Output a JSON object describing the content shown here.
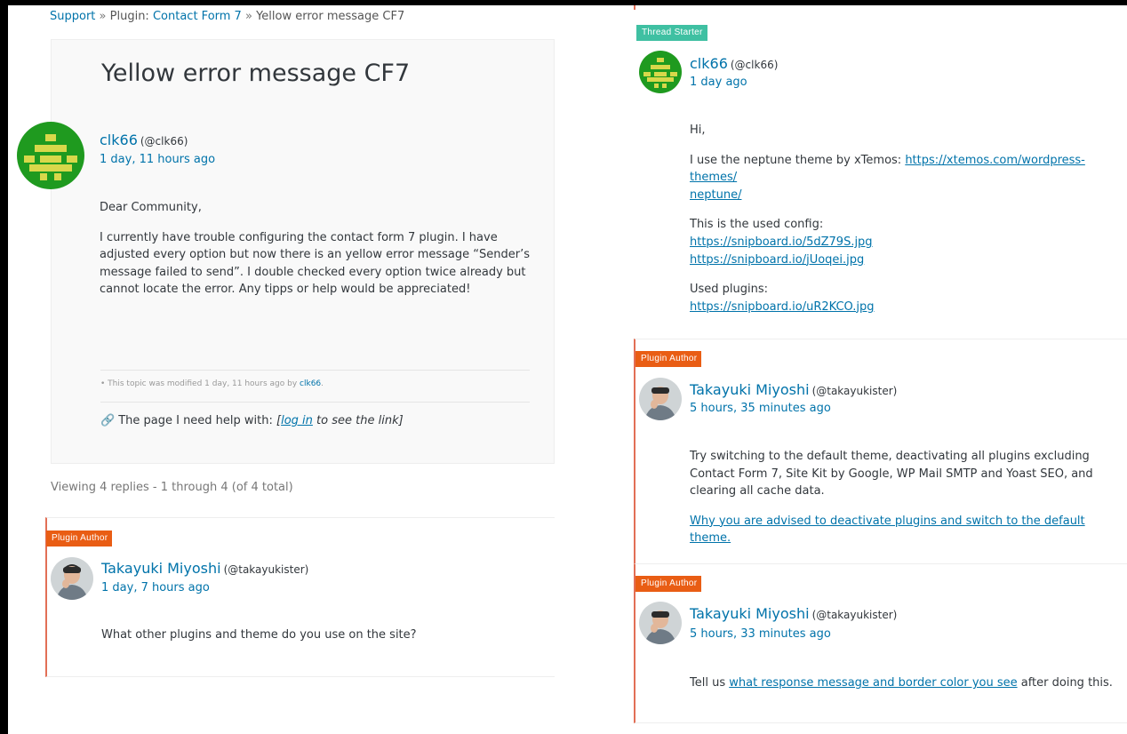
{
  "breadcrumb": {
    "support": "Support",
    "sep1": "»",
    "plugin_prefix": "Plugin:",
    "plugin_name": "Contact Form 7",
    "sep2": "»",
    "current": "Yellow error message CF7"
  },
  "topic": {
    "title": "Yellow error message CF7",
    "author_name": "clk66",
    "author_handle": "(@clk66)",
    "time": "1 day, 11 hours ago",
    "paragraphs": [
      "Dear Community,",
      "I currently have trouble configuring the contact form 7 plugin. I have adjusted every option but now there is an yellow error message “Sender’s message failed to send”. I double checked every option twice already but cannot locate the error. Any tipps or help would be appreciated!"
    ],
    "mod_note_prefix": "• This topic was modified 1 day, 11 hours ago by",
    "mod_note_user": "clk66",
    "mod_note_suffix": ".",
    "help_label": "The page I need help with:",
    "help_link_open": "[",
    "help_login": "log in",
    "help_link_rest": " to see the link]"
  },
  "viewing_text": "Viewing 4 replies - 1 through 4 (of 4 total)",
  "replies_left": [
    {
      "badge": "Plugin Author",
      "author_name": "Takayuki Miyoshi",
      "author_handle": "(@takayukister)",
      "time": "1 day, 7 hours ago",
      "text": "What other plugins and theme do you use on the site?"
    }
  ],
  "starter_reply": {
    "badge": "Thread Starter",
    "author_name": "clk66",
    "author_handle": "(@clk66)",
    "time": "1 day ago",
    "hi": "Hi,",
    "theme_text": "I use the neptune theme by xTemos: ",
    "theme_link_1": "https://xtemos.com/wordpress-themes/",
    "theme_link_2": "neptune/",
    "config_label": "This is the used config:",
    "config_link_1": "https://snipboard.io/5dZ79S.jpg",
    "config_link_2": "https://snipboard.io/jUoqei.jpg",
    "plugins_label": "Used plugins:",
    "plugins_link": "https://snipboard.io/uR2KCO.jpg"
  },
  "author_reply_1": {
    "badge": "Plugin Author",
    "author_name": "Takayuki Miyoshi",
    "author_handle": "(@takayukister)",
    "time": "5 hours, 35 minutes ago",
    "text": "Try switching to the default theme, deactivating all plugins excluding Contact Form 7, Site Kit by Google, WP Mail SMTP and Yoast SEO, and clearing all cache data.",
    "link": "Why you are advised to deactivate plugins and switch to the default theme."
  },
  "author_reply_2": {
    "badge": "Plugin Author",
    "author_name": "Takayuki Miyoshi",
    "author_handle": "(@takayukister)",
    "time": "5 hours, 33 minutes ago",
    "text_before": "Tell us ",
    "link": "what response message and border color you see",
    "text_after": " after doing this."
  },
  "colors": {
    "link": "#0073aa",
    "plugin_author_badge": "#e95d14",
    "thread_starter_badge": "#3fc0a2",
    "reply_border": "#e26f56",
    "identicon_green": "#1f9a1f",
    "identicon_yellow": "#d8d84a"
  },
  "icons": {
    "link_icon": "link-icon",
    "clk66_avatar": "identicon-avatar",
    "takayuki_avatar": "photo-avatar"
  }
}
